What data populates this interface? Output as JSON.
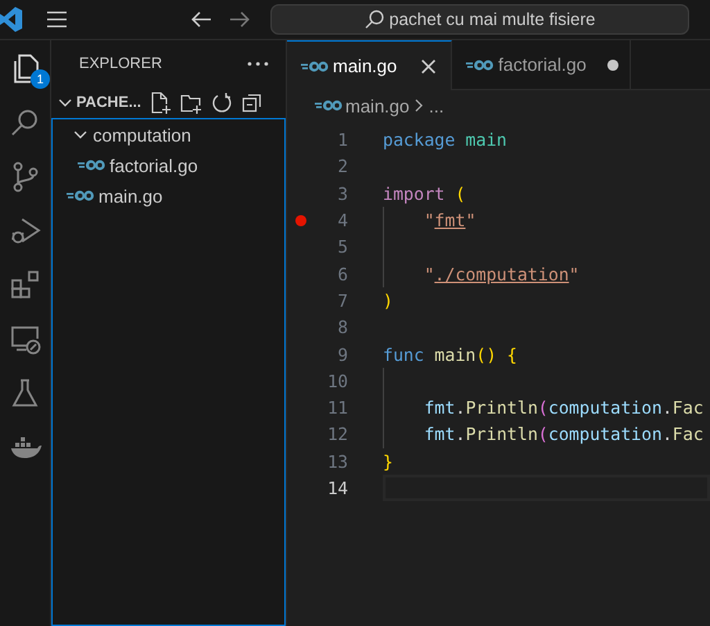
{
  "title_bar": {
    "search": "pachet cu mai multe fisiere"
  },
  "activity_bar": [
    {
      "kind": "explorer",
      "selected": true,
      "badge": "1"
    },
    {
      "kind": "search",
      "selected": false
    },
    {
      "kind": "source-control",
      "selected": false
    },
    {
      "kind": "run-debug",
      "selected": false
    },
    {
      "kind": "extensions",
      "selected": false
    },
    {
      "kind": "remote",
      "selected": false
    },
    {
      "kind": "testing",
      "selected": false
    },
    {
      "kind": "docker",
      "selected": false
    }
  ],
  "sidebar": {
    "title": "EXPLORER",
    "folder": "PACHE...",
    "tree": [
      {
        "label": "computation",
        "kind": "folder",
        "expanded": true,
        "children": [
          {
            "label": "factorial.go",
            "kind": "go"
          }
        ]
      },
      {
        "label": "main.go",
        "kind": "go"
      }
    ]
  },
  "tabs": [
    {
      "label": "main.go",
      "selected": true,
      "modified": false
    },
    {
      "label": "factorial.go",
      "selected": false,
      "modified": true
    }
  ],
  "breadcrumb": [
    "main.go",
    "..."
  ],
  "code": [
    {
      "number": "1",
      "breakpoint": false,
      "current": false,
      "guide": false,
      "tokens": [
        {
          "text": "package",
          "kind": "keyword"
        },
        {
          "text": " main",
          "kind": "type"
        }
      ]
    },
    {
      "number": "2",
      "breakpoint": false,
      "current": false,
      "guide": false
    },
    {
      "number": "3",
      "breakpoint": false,
      "current": false,
      "guide": false,
      "tokens": [
        {
          "text": "import",
          "kind": "control"
        },
        {
          "text": " (",
          "kind": "bracket1"
        }
      ]
    },
    {
      "number": "4",
      "breakpoint": true,
      "current": false,
      "guide": true,
      "tokens": [
        {
          "text": "\"",
          "kind": "string"
        },
        {
          "text": "fmt",
          "kind": "link"
        },
        {
          "text": "\"",
          "kind": "string"
        }
      ]
    },
    {
      "number": "5",
      "breakpoint": false,
      "current": false,
      "guide": true
    },
    {
      "number": "6",
      "breakpoint": false,
      "current": false,
      "guide": true,
      "tokens": [
        {
          "text": "\"",
          "kind": "string"
        },
        {
          "text": "./computation",
          "kind": "link"
        },
        {
          "text": "\"",
          "kind": "string"
        }
      ]
    },
    {
      "number": "7",
      "breakpoint": false,
      "current": false,
      "guide": false,
      "tokens": [
        {
          "text": ")",
          "kind": "bracket1"
        }
      ]
    },
    {
      "number": "8",
      "breakpoint": false,
      "current": false,
      "guide": false
    },
    {
      "number": "9",
      "breakpoint": false,
      "current": false,
      "guide": false,
      "tokens": [
        {
          "text": "func",
          "kind": "keyword"
        },
        {
          "text": " main",
          "kind": "function"
        },
        {
          "text": "()",
          "kind": "bracket1"
        },
        {
          "text": " {",
          "kind": "bracket1"
        }
      ]
    },
    {
      "number": "10",
      "breakpoint": false,
      "current": false,
      "guide": true
    },
    {
      "number": "11",
      "breakpoint": false,
      "current": false,
      "guide": true,
      "tokens": [
        {
          "text": "fmt",
          "kind": "variable"
        },
        {
          "text": ".",
          "kind": "plain"
        },
        {
          "text": "Println",
          "kind": "function"
        },
        {
          "text": "(",
          "kind": "bracket2"
        },
        {
          "text": "computation",
          "kind": "variable"
        },
        {
          "text": ".",
          "kind": "plain"
        },
        {
          "text": "Fac",
          "kind": "function"
        }
      ]
    },
    {
      "number": "12",
      "breakpoint": false,
      "current": false,
      "guide": true,
      "tokens": [
        {
          "text": "fmt",
          "kind": "variable"
        },
        {
          "text": ".",
          "kind": "plain"
        },
        {
          "text": "Println",
          "kind": "function"
        },
        {
          "text": "(",
          "kind": "bracket2"
        },
        {
          "text": "computation",
          "kind": "variable"
        },
        {
          "text": ".",
          "kind": "plain"
        },
        {
          "text": "Fac",
          "kind": "function"
        }
      ]
    },
    {
      "number": "13",
      "breakpoint": false,
      "current": false,
      "guide": false,
      "tokens": [
        {
          "text": "}",
          "kind": "bracket1"
        }
      ]
    },
    {
      "number": "14",
      "breakpoint": false,
      "current": true,
      "guide": false
    }
  ]
}
